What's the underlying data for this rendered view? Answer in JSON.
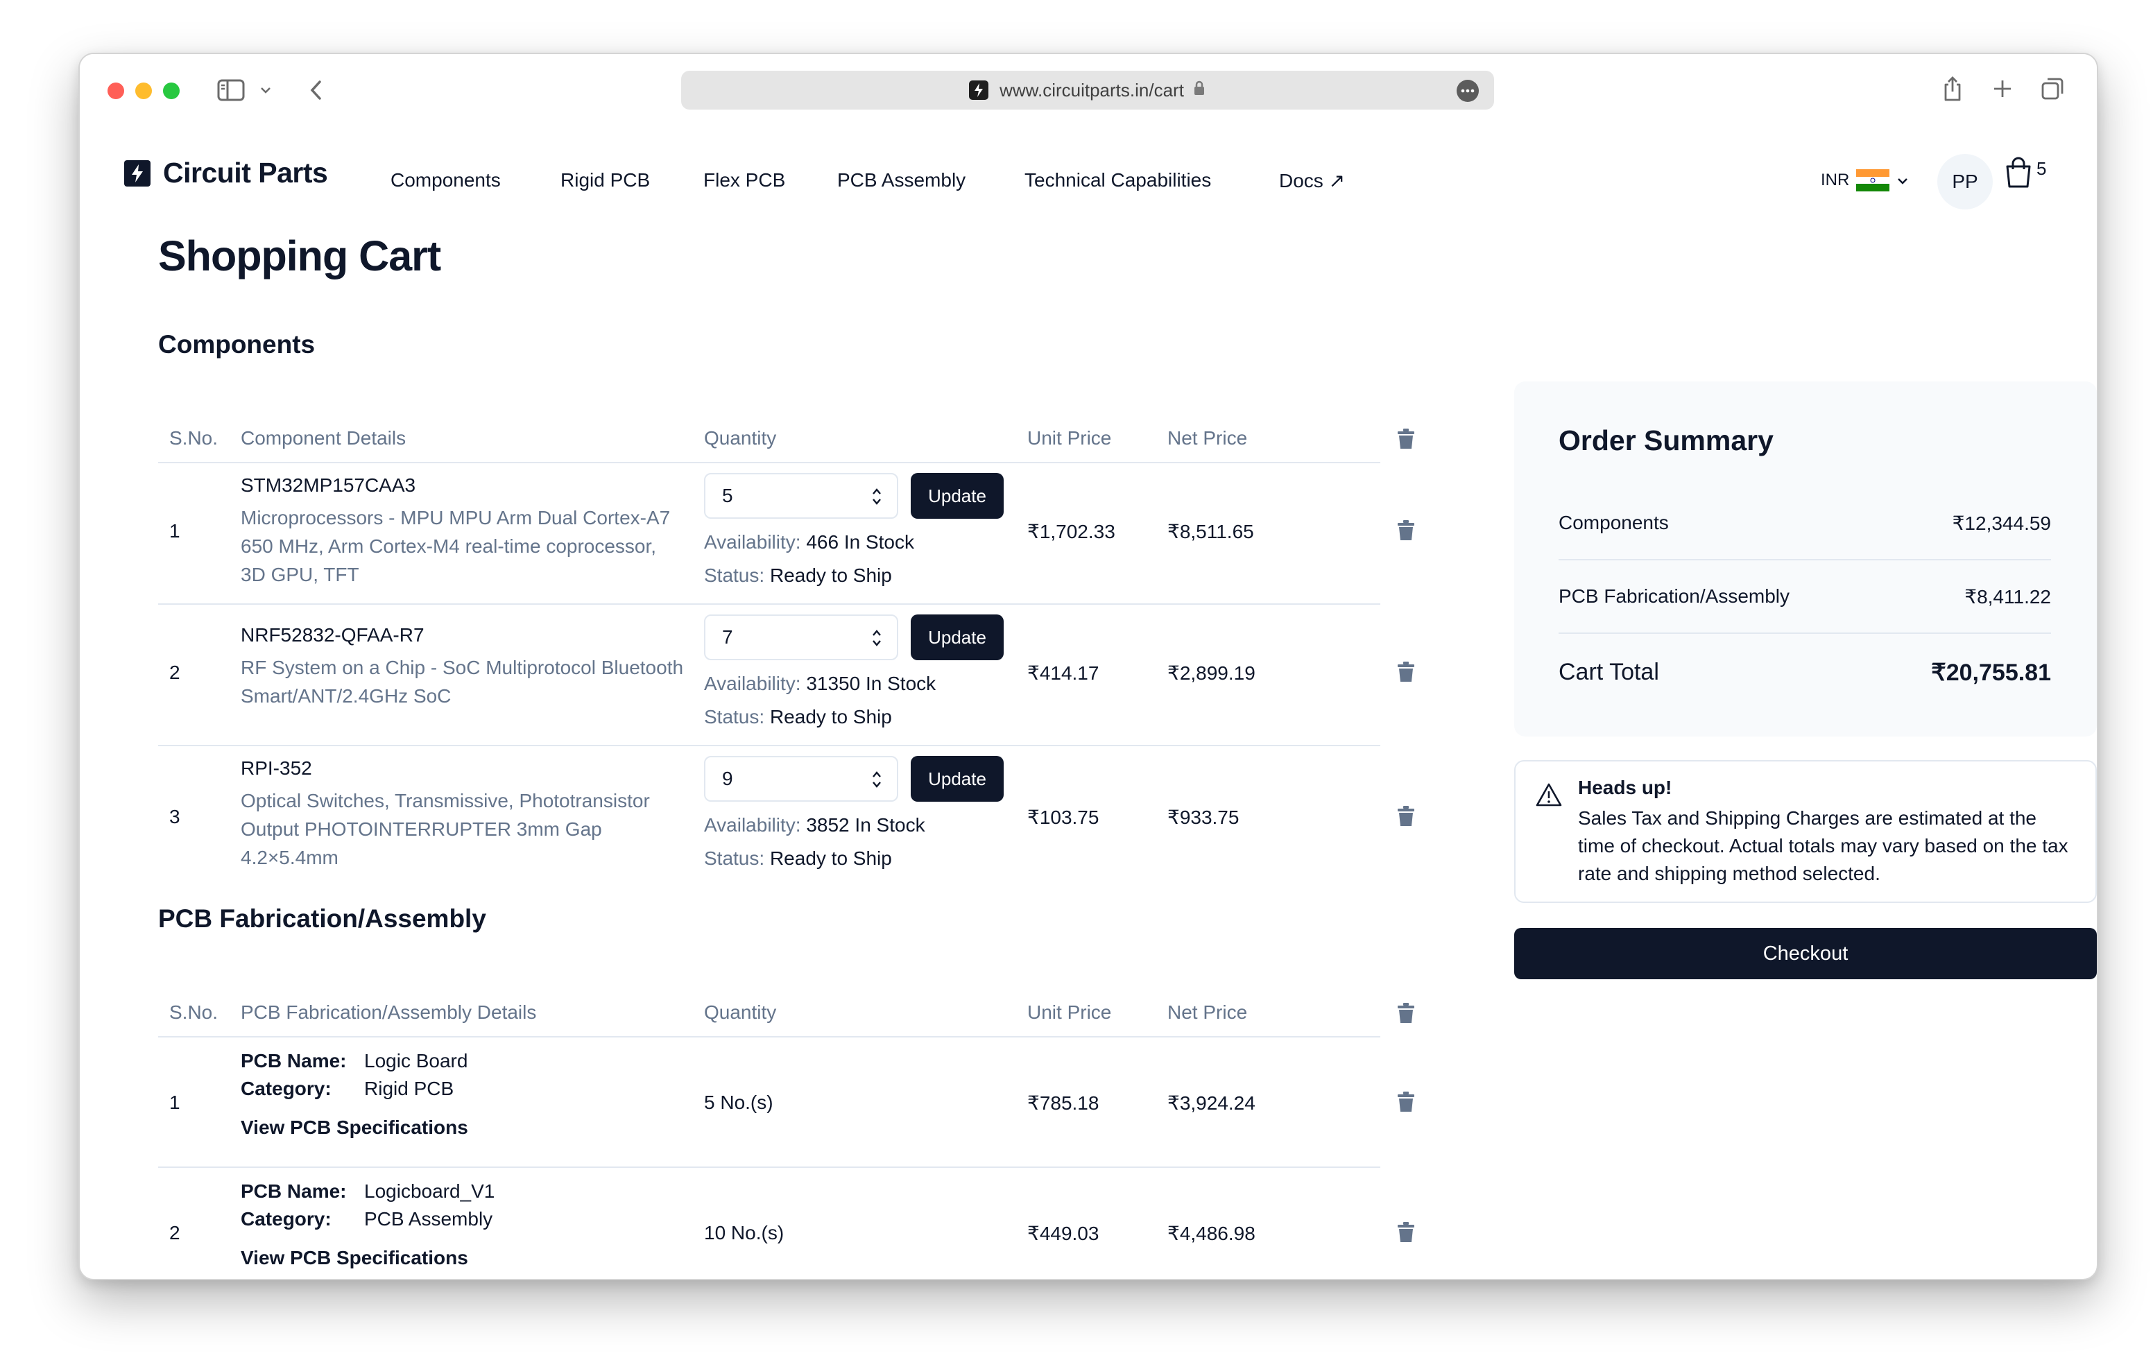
{
  "browser": {
    "url": "www.circuitparts.in/cart"
  },
  "nav": {
    "brand": "Circuit Parts",
    "links": [
      "Components",
      "Rigid PCB",
      "Flex PCB",
      "PCB Assembly",
      "Technical Capabilities",
      "Docs ↗"
    ],
    "currency": "INR",
    "avatar_initials": "PP",
    "cart_count": "5"
  },
  "page": {
    "title": "Shopping Cart"
  },
  "components": {
    "section_title": "Components",
    "headers": {
      "sno": "S.No.",
      "details": "Component Details",
      "quantity": "Quantity",
      "unit_price": "Unit Price",
      "net_price": "Net Price"
    },
    "update_label": "Update",
    "availability_label": "Availability:",
    "status_label": "Status:",
    "rows": [
      {
        "sno": "1",
        "mpn": "STM32MP157CAA3",
        "description": "Microprocessors - MPU MPU Arm Dual Cortex-A7 650 MHz, Arm Cortex-M4 real-time coprocessor, 3D GPU, TFT",
        "quantity": "5",
        "availability": "466 In Stock",
        "status": "Ready to Ship",
        "unit_price": "₹1,702.33",
        "net_price": "₹8,511.65"
      },
      {
        "sno": "2",
        "mpn": "NRF52832-QFAA-R7",
        "description": "RF System on a Chip - SoC Multiprotocol Bluetooth Smart/ANT/2.4GHz SoC",
        "quantity": "7",
        "availability": "31350 In Stock",
        "status": "Ready to Ship",
        "unit_price": "₹414.17",
        "net_price": "₹2,899.19"
      },
      {
        "sno": "3",
        "mpn": "RPI-352",
        "description": "Optical Switches, Transmissive, Phototransistor Output PHOTOINTERRUPTER 3mm Gap 4.2×5.4mm",
        "quantity": "9",
        "availability": "3852 In Stock",
        "status": "Ready to Ship",
        "unit_price": "₹103.75",
        "net_price": "₹933.75"
      }
    ]
  },
  "pcb": {
    "section_title": "PCB Fabrication/Assembly",
    "headers": {
      "sno": "S.No.",
      "details": "PCB Fabrication/Assembly Details",
      "quantity": "Quantity",
      "unit_price": "Unit Price",
      "net_price": "Net Price"
    },
    "name_label": "PCB Name:",
    "category_label": "Category:",
    "spec_link": "View PCB Specifications",
    "rows": [
      {
        "sno": "1",
        "name": "Logic Board",
        "category": "Rigid PCB",
        "quantity": "5 No.(s)",
        "unit_price": "₹785.18",
        "net_price": "₹3,924.24"
      },
      {
        "sno": "2",
        "name": "Logicboard_V1",
        "category": "PCB Assembly",
        "quantity": "10 No.(s)",
        "unit_price": "₹449.03",
        "net_price": "₹4,486.98"
      }
    ]
  },
  "summary": {
    "title": "Order Summary",
    "components_label": "Components",
    "components_value": "₹12,344.59",
    "pcb_label": "PCB Fabrication/Assembly",
    "pcb_value": "₹8,411.22",
    "total_label": "Cart Total",
    "total_value": "₹20,755.81"
  },
  "alert": {
    "title": "Heads up!",
    "body": "Sales Tax and Shipping Charges are estimated at the time of checkout. Actual totals may vary based on the tax rate and shipping method selected."
  },
  "checkout_label": "Checkout",
  "colors": {
    "primary": "#0f172a",
    "muted": "#64748b",
    "border": "#e2e8f0",
    "summary_bg": "#f8fafc"
  }
}
